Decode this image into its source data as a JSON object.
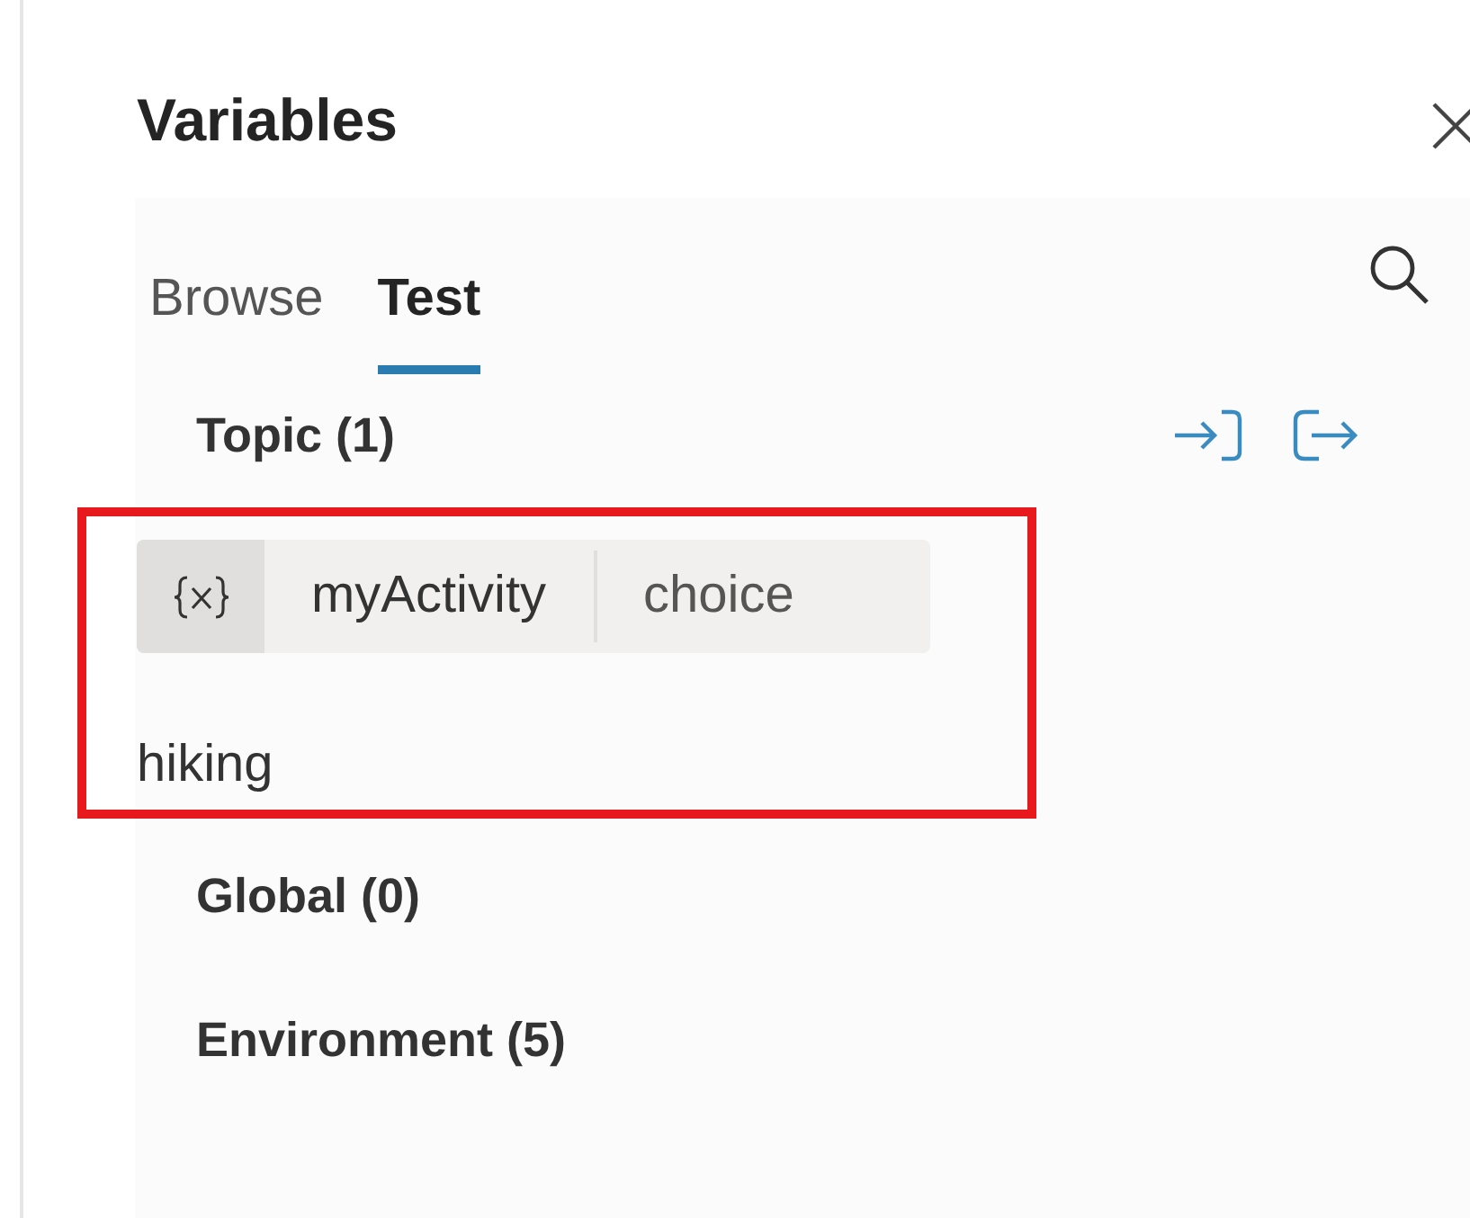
{
  "panel": {
    "title": "Variables"
  },
  "tabs": [
    {
      "label": "Browse",
      "selected": false
    },
    {
      "label": "Test",
      "selected": true
    }
  ],
  "sections": [
    {
      "label": "Topic (1)",
      "variables": [
        {
          "name": "myActivity",
          "type": "choice",
          "value": "hiking",
          "highlighted": true
        }
      ]
    },
    {
      "label": "Global (0)"
    },
    {
      "label": "Environment (5)"
    }
  ]
}
